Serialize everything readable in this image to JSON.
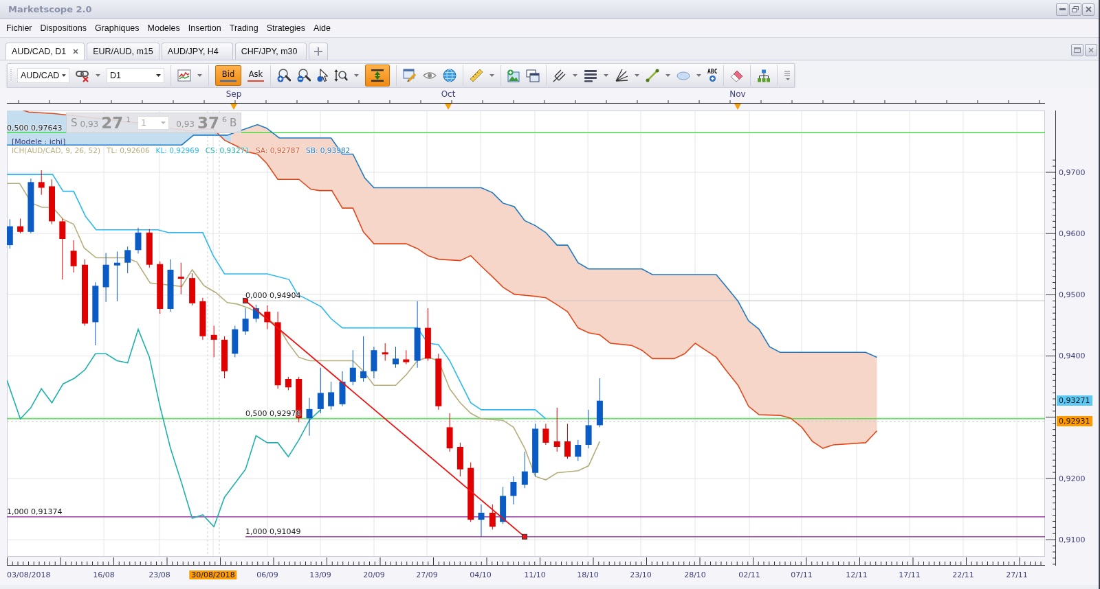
{
  "window": {
    "title": "Marketscope 2.0"
  },
  "menu": [
    "Fichier",
    "Dispositions",
    "Graphiques",
    "Modeles",
    "Insertion",
    "Trading",
    "Strategies",
    "Aide"
  ],
  "tabs": [
    {
      "label": "AUD/CAD, D1",
      "selected": true,
      "closable": true
    },
    {
      "label": "EUR/AUD, m15",
      "selected": false,
      "closable": false
    },
    {
      "label": "AUD/JPY, H4",
      "selected": false,
      "closable": false
    },
    {
      "label": "CHF/JPY, m30",
      "selected": false,
      "closable": false
    }
  ],
  "toolbar": {
    "groups": [
      [
        {
          "kind": "select",
          "value": "AUD/CAD"
        },
        {
          "kind": "tool",
          "on": false,
          "menu": true
        },
        {
          "kind": "select",
          "value": "D1"
        }
      ],
      [
        {
          "kind": "tool",
          "on": false,
          "menu": true
        }
      ],
      [
        {
          "kind": "price",
          "label": "Bid",
          "selected": true,
          "color": "#1e6fd6"
        },
        {
          "kind": "price",
          "label": "Ask",
          "selected": false,
          "color": "#e8452c"
        }
      ],
      [
        {
          "kind": "tool",
          "on": false,
          "menu": false
        },
        {
          "kind": "tool",
          "on": false,
          "menu": false
        },
        {
          "kind": "tool",
          "on": false,
          "menu": false
        },
        {
          "kind": "tool",
          "on": false,
          "menu": true
        },
        {
          "kind": "tool",
          "on": true,
          "menu": false
        }
      ],
      [
        {
          "kind": "tool",
          "on": false,
          "menu": false
        },
        {
          "kind": "tool",
          "on": false,
          "menu": false
        },
        {
          "kind": "tool",
          "on": false,
          "menu": false
        }
      ],
      [
        {
          "kind": "tool",
          "on": false,
          "menu": true
        }
      ],
      [
        {
          "kind": "tool",
          "on": false,
          "menu": false
        },
        {
          "kind": "tool",
          "on": false,
          "menu": false
        }
      ],
      [
        {
          "kind": "tool",
          "on": false,
          "menu": true
        },
        {
          "kind": "tool",
          "on": false,
          "menu": true
        },
        {
          "kind": "tool",
          "on": false,
          "menu": true
        },
        {
          "kind": "tool",
          "on": false,
          "menu": true
        },
        {
          "kind": "tool",
          "on": false,
          "menu": true
        },
        {
          "kind": "tool",
          "on": false,
          "menu": false,
          "label": "ABC"
        }
      ],
      [
        {
          "kind": "tool",
          "on": false,
          "menu": false
        }
      ],
      [
        {
          "kind": "tool",
          "on": false,
          "menu": false
        }
      ],
      [
        {
          "kind": "tool",
          "on": false,
          "menu": false
        }
      ]
    ]
  },
  "chart": {
    "months": [
      "Sep",
      "Oct",
      "Nov"
    ],
    "fib_labels": [
      "0,500 0,97643",
      "1,000 0,91374",
      "0,000 0,94904",
      "0,500 0,92976",
      "1,000 0,91049"
    ],
    "trade_panel": {
      "sell_label": "S",
      "sell_big_figure": "0,93",
      "sell_pips": "27",
      "sell_fraction": "1",
      "amount": "1",
      "buy_big_figure": "0,93",
      "buy_pips": "37",
      "buy_fraction": "6",
      "buy_label": "B"
    },
    "model_label": "[Modele : ichi]",
    "indicator": {
      "name": "ICH(AUD/CAD, 9, 26, 52)",
      "values": [
        {
          "label": "TL: 0,92606",
          "color": "#b5ad7c"
        },
        {
          "label": "KL: 0,92969",
          "color": "#2ab8f2"
        },
        {
          "label": "CS: 0,93271",
          "color": "#1fb0aa"
        },
        {
          "label": "SA: 0,92787",
          "color": "#e0481c"
        },
        {
          "label": "SB: 0,93982",
          "color": "#1e78c2"
        }
      ]
    },
    "price_labels": [
      "0,9700",
      "0,9600",
      "0,9500",
      "0,9400",
      "0,9200",
      "0,9100"
    ],
    "price_badges": [
      {
        "label": "0,93271",
        "color": "#5cc8f5"
      },
      {
        "label": "0,92931",
        "color": "#ff9900"
      }
    ],
    "date_labels": [
      {
        "label": "03/08/2018",
        "highlighted": false
      },
      {
        "label": "16/08",
        "highlighted": false
      },
      {
        "label": "23/08",
        "highlighted": false
      },
      {
        "label": "30/08/2018",
        "highlighted": true
      },
      {
        "label": "06/09",
        "highlighted": false
      },
      {
        "label": "13/09",
        "highlighted": false
      },
      {
        "label": "20/09",
        "highlighted": false
      },
      {
        "label": "27/09",
        "highlighted": false
      },
      {
        "label": "04/10",
        "highlighted": false
      },
      {
        "label": "11/10",
        "highlighted": false
      },
      {
        "label": "18/10",
        "highlighted": false
      },
      {
        "label": "23/10",
        "highlighted": false
      },
      {
        "label": "28/10",
        "highlighted": false
      },
      {
        "label": "02/11",
        "highlighted": false
      },
      {
        "label": "07/11",
        "highlighted": false
      },
      {
        "label": "12/11",
        "highlighted": false
      },
      {
        "label": "17/11",
        "highlighted": false
      },
      {
        "label": "22/11",
        "highlighted": false
      },
      {
        "label": "27/11",
        "highlighted": false
      }
    ]
  }
}
